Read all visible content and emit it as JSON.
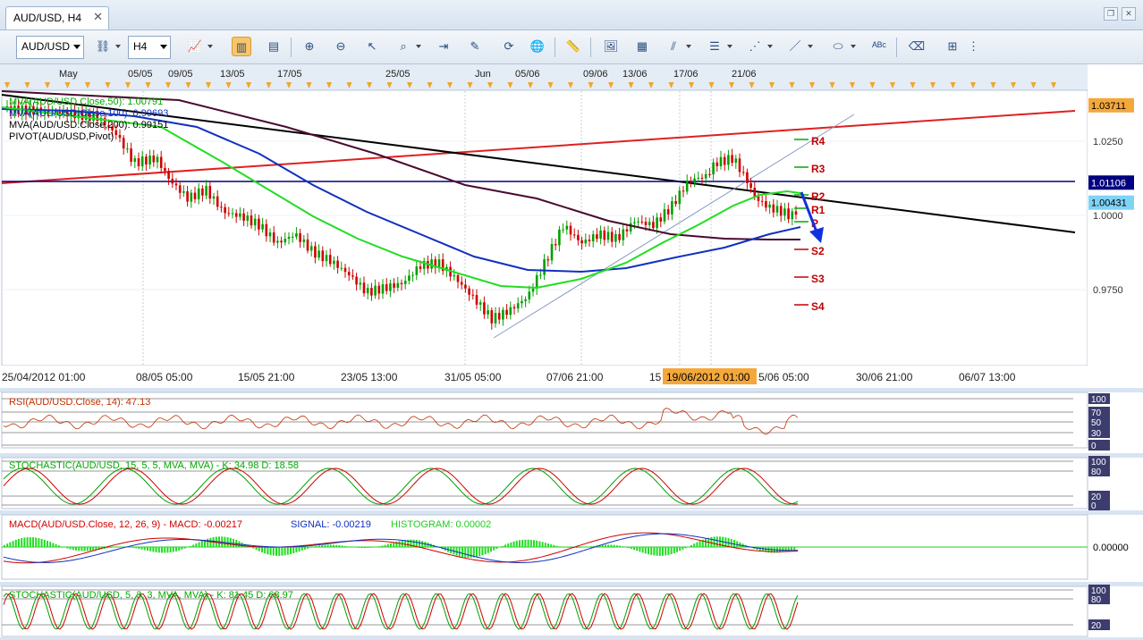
{
  "window": {
    "tab_title": "AUD/USD, H4"
  },
  "toolbar": {
    "symbol": "AUD/USD",
    "timeframe": "H4"
  },
  "main": {
    "indicators": [
      {
        "label": "MVA(AUD/USD.Close,50): 1.00791",
        "color": "#00cc00"
      },
      {
        "label": "MVA(AUD/USD.Close,100): 0.99693",
        "color": "#0000cc"
      },
      {
        "label": "MVA(AUD/USD.Close,200): 0.99151",
        "color": "#000000"
      },
      {
        "label": "PIVOT(AUD/USD,Pivot)",
        "color": "#000000"
      }
    ],
    "price_ticks": [
      "1.0250",
      "1.0000",
      "0.9750"
    ],
    "price_badges": [
      {
        "value": "1.03711",
        "color": "#f4a83c"
      },
      {
        "value": "1.01106",
        "color": "#000080"
      },
      {
        "value": "1.00431",
        "color": "#7fd3f7"
      }
    ],
    "pivot_labels": [
      "R4",
      "R3",
      "R2",
      "R1",
      "P",
      "S2",
      "S3",
      "S4"
    ],
    "top_dates": [
      "May",
      "05/05",
      "09/05",
      "13/05",
      "17/05",
      "25/05",
      "Jun",
      "05/06",
      "09/06",
      "13/06",
      "17/06",
      "21/06"
    ],
    "bottom_dates": [
      "25/04/2012 01:00",
      "08/05 05:00",
      "15/05 21:00",
      "23/05 13:00",
      "31/05 05:00",
      "07/06 21:00",
      "15",
      "5/06 05:00",
      "30/06 21:00",
      "06/07 13:00"
    ],
    "cursor_date": "19/06/2012 01:00"
  },
  "panels": {
    "rsi": {
      "label": "RSI(AUD/USD.Close, 14): 47.13",
      "ticks": [
        "100",
        "70",
        "50",
        "30",
        "0"
      ]
    },
    "stoch1": {
      "label": "STOCHASTIC(AUD/USD, 15, 5, 5, MVA, MVA) -  K: 34.98  D: 18.58",
      "ticks": [
        "100",
        "80",
        "20",
        "0"
      ]
    },
    "macd": {
      "label1": "MACD(AUD/USD.Close, 12, 26, 9) -  MACD: -0.00217",
      "label2": "SIGNAL: -0.00219",
      "label3": "HISTOGRAM: 0.00002",
      "tick": "0.00000"
    },
    "stoch2": {
      "label": "STOCHASTIC(AUD/USD, 5, 3, 3, MVA, MVA) -  K: 81.45  D: 68.97",
      "ticks": [
        "100",
        "80",
        "20"
      ]
    }
  },
  "colors": {
    "bull": "#00a000",
    "bear": "#d00000",
    "ma50": "#22dd22",
    "ma100": "#1030c0",
    "ma200": "#4a0a30",
    "trend_red": "#e02020",
    "trend_black": "#000000",
    "arrow": "#1030e0"
  }
}
